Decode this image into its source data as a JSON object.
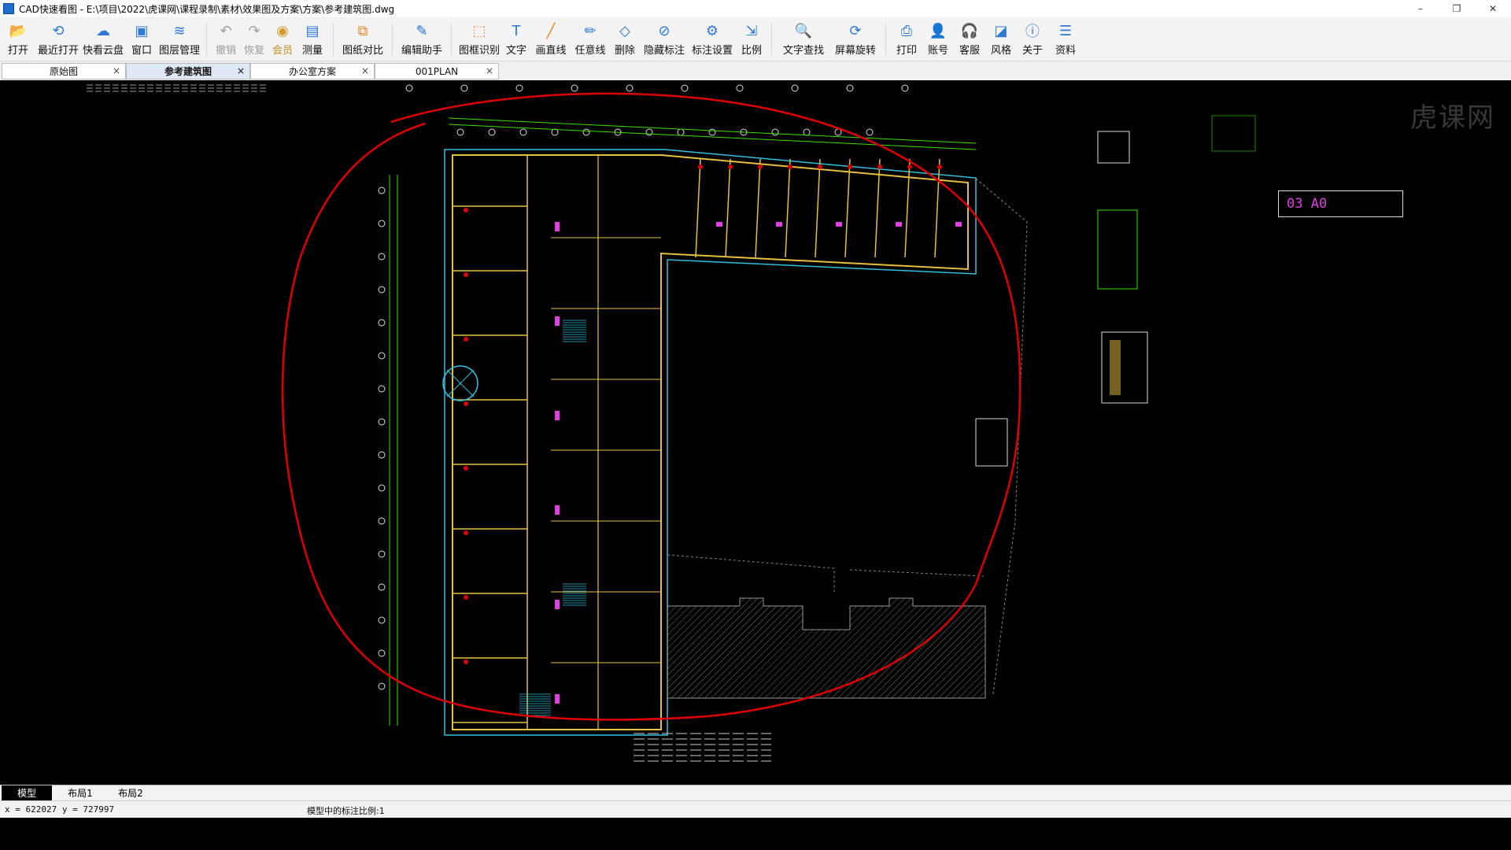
{
  "window": {
    "title": "CAD快速看图 - E:\\项目\\2022\\虎课网\\课程录制\\素材\\效果图及方案\\方案\\参考建筑图.dwg",
    "minimize": "–",
    "restore": "❐",
    "close": "✕"
  },
  "toolbar": {
    "items": [
      {
        "label": "打开",
        "icon": "folder-open-icon",
        "color": "#2b79d8"
      },
      {
        "label": "最近打开",
        "icon": "history-icon",
        "color": "#2b79d8"
      },
      {
        "label": "快看云盘",
        "icon": "cloud-icon",
        "color": "#2b79d8"
      },
      {
        "label": "窗口",
        "icon": "window-icon",
        "color": "#2b79d8"
      },
      {
        "label": "图层管理",
        "icon": "layers-icon",
        "color": "#2b79d8"
      },
      {
        "label": "撤销",
        "icon": "undo-icon",
        "color": "#a0a0a0"
      },
      {
        "label": "恢复",
        "icon": "redo-icon",
        "color": "#a0a0a0"
      },
      {
        "label": "会员",
        "icon": "vip-icon",
        "color": "#d69a2a"
      },
      {
        "label": "测量",
        "icon": "measure-icon",
        "color": "#2b79d8"
      },
      {
        "label": "图纸对比",
        "icon": "compare-icon",
        "color": "#e58a2a"
      },
      {
        "label": "编辑助手",
        "icon": "edit-assistant-icon",
        "color": "#1e6fd0"
      },
      {
        "label": "图框识别",
        "icon": "frame-detect-icon",
        "color": "#e58a2a"
      },
      {
        "label": "文字",
        "icon": "text-icon",
        "color": "#2b79d8"
      },
      {
        "label": "画直线",
        "icon": "line-icon",
        "color": "#e58a2a"
      },
      {
        "label": "任意线",
        "icon": "pencil-icon",
        "color": "#2b79d8"
      },
      {
        "label": "删除",
        "icon": "eraser-icon",
        "color": "#2b79d8"
      },
      {
        "label": "隐藏标注",
        "icon": "hide-annotation-icon",
        "color": "#2b79d8"
      },
      {
        "label": "标注设置",
        "icon": "annotation-settings-icon",
        "color": "#2b79d8"
      },
      {
        "label": "比例",
        "icon": "scale-icon",
        "color": "#2b79d8"
      },
      {
        "label": "文字查找",
        "icon": "text-search-icon",
        "color": "#2b79d8"
      },
      {
        "label": "屏幕旋转",
        "icon": "rotate-screen-icon",
        "color": "#2b79d8"
      },
      {
        "label": "打印",
        "icon": "printer-icon",
        "color": "#2b79d8"
      },
      {
        "label": "账号",
        "icon": "user-icon",
        "color": "#2b79d8"
      },
      {
        "label": "客服",
        "icon": "headset-icon",
        "color": "#2b79d8"
      },
      {
        "label": "风格",
        "icon": "style-icon",
        "color": "#2b79d8"
      },
      {
        "label": "关于",
        "icon": "info-icon",
        "color": "#2b79d8"
      },
      {
        "label": "资料",
        "icon": "document-icon",
        "color": "#2b79d8"
      }
    ]
  },
  "tabs": [
    {
      "label": "原始图",
      "active": false
    },
    {
      "label": "参考建筑图",
      "active": true
    },
    {
      "label": "办公室方案",
      "active": false
    },
    {
      "label": "001PLAN",
      "active": false
    }
  ],
  "tab_close": "×",
  "drawing": {
    "title_block_text": "03   A0",
    "markup_color": "#e00000"
  },
  "layout_tabs": [
    "模型",
    "布局1",
    "布局2"
  ],
  "status": {
    "coords": "x = 622027  y = 727997",
    "scale_text": "模型中的标注比例:1"
  },
  "watermark": "虎课网"
}
